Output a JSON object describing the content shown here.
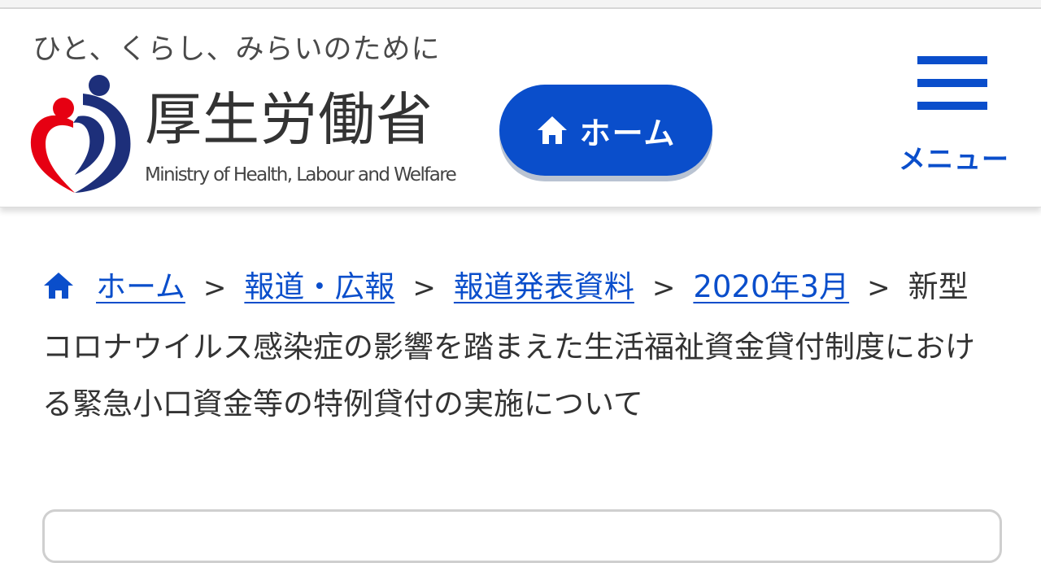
{
  "header": {
    "tagline": "ひと、くらし、みらいのために",
    "logo_name": "厚生労働省",
    "logo_en": "Ministry of Health, Labour and Welfare",
    "home_button_label": "ホーム",
    "menu_button_label": "メニュー"
  },
  "breadcrumb": {
    "items": [
      "ホーム",
      "報道・広報",
      "報道発表資料",
      "2020年3月"
    ],
    "separator": ">",
    "current": "新型コロナウイルス感染症の影響を踏まえた生活福祉資金貸付制度における緊急小口資金等の特例貸付の実施について"
  },
  "colors": {
    "accent": "#0a4ecb",
    "logo_red": "#e60012",
    "logo_navy": "#1d2f7a"
  },
  "icons": [
    "home-icon",
    "hamburger-menu-icon",
    "ministry-logo-icon"
  ]
}
